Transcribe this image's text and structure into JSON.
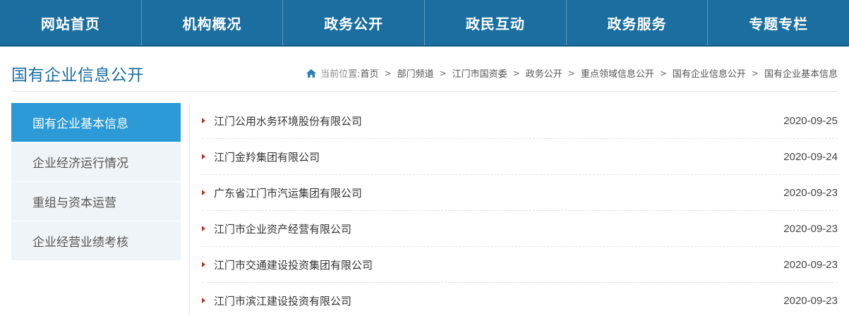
{
  "nav": [
    "网站首页",
    "机构概况",
    "政务公开",
    "政民互动",
    "政务服务",
    "专题专栏"
  ],
  "page_title": "国有企业信息公开",
  "breadcrumb": {
    "prefix": "当前位置:",
    "items": [
      "首页",
      "部门频道",
      "江门市国资委",
      "政务公开",
      "重点领域信息公开",
      "国有企业信息公开",
      "国有企业基本信息"
    ]
  },
  "sidebar": [
    {
      "label": "国有企业基本信息",
      "active": true
    },
    {
      "label": "企业经济运行情况",
      "active": false
    },
    {
      "label": "重组与资本运营",
      "active": false
    },
    {
      "label": "企业经营业绩考核",
      "active": false
    }
  ],
  "list": [
    {
      "title": "江门公用水务环境股份有限公司",
      "date": "2020-09-25"
    },
    {
      "title": "江门金羚集团有限公司",
      "date": "2020-09-24"
    },
    {
      "title": "广东省江门市汽运集团有限公司",
      "date": "2020-09-23"
    },
    {
      "title": "江门市企业资产经营有限公司",
      "date": "2020-09-23"
    },
    {
      "title": "江门市交通建设投资集团有限公司",
      "date": "2020-09-23"
    },
    {
      "title": "江门市滨江建设投资有限公司",
      "date": "2020-09-23"
    }
  ],
  "colors": {
    "nav_bg": "#1a6ea0",
    "active_side": "#2b9ad6",
    "bullet": "#b33a2a"
  }
}
